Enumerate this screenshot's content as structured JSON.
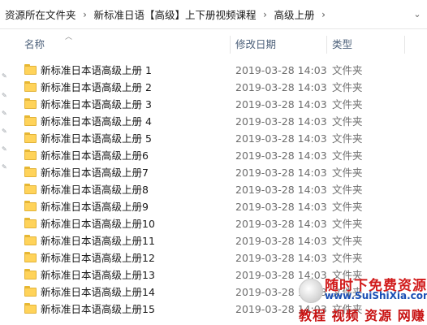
{
  "breadcrumb": {
    "items": [
      "资源所在文件夹",
      "新标准日语【高级】上下册视频课程",
      "高级上册"
    ],
    "separator": "›"
  },
  "columns": {
    "name": "名称",
    "date": "修改日期",
    "type": "类型"
  },
  "rows": [
    {
      "name": "新标准日本语高级上册 1",
      "date": "2019-03-28 14:03",
      "type": "文件夹"
    },
    {
      "name": "新标准日本语高级上册 2",
      "date": "2019-03-28 14:03",
      "type": "文件夹"
    },
    {
      "name": "新标准日本语高级上册 3",
      "date": "2019-03-28 14:03",
      "type": "文件夹"
    },
    {
      "name": "新标准日本语高级上册 4",
      "date": "2019-03-28 14:03",
      "type": "文件夹"
    },
    {
      "name": "新标准日本语高级上册 5",
      "date": "2019-03-28 14:03",
      "type": "文件夹"
    },
    {
      "name": "新标准日本语高级上册6",
      "date": "2019-03-28 14:03",
      "type": "文件夹"
    },
    {
      "name": "新标准日本语高级上册7",
      "date": "2019-03-28 14:03",
      "type": "文件夹"
    },
    {
      "name": "新标准日本语高级上册8",
      "date": "2019-03-28 14:03",
      "type": "文件夹"
    },
    {
      "name": "新标准日本语高级上册9",
      "date": "2019-03-28 14:03",
      "type": "文件夹"
    },
    {
      "name": "新标准日本语高级上册10",
      "date": "2019-03-28 14:03",
      "type": "文件夹"
    },
    {
      "name": "新标准日本语高级上册11",
      "date": "2019-03-28 14:03",
      "type": "文件夹"
    },
    {
      "name": "新标准日本语高级上册12",
      "date": "2019-03-28 14:03",
      "type": "文件夹"
    },
    {
      "name": "新标准日本语高级上册13",
      "date": "2019-03-28 14:03",
      "type": "文件夹"
    },
    {
      "name": "新标准日本语高级上册14",
      "date": "2019-03-28 14:03",
      "type": "文件夹"
    },
    {
      "name": "新标准日本语高级上册15",
      "date": "2019-03-28 14:03",
      "type": "文件夹"
    }
  ],
  "watermark": {
    "line1": "随时下免费资源网",
    "line2": "www.SuiShiXia.com",
    "line3": "教程 视频 资源 网赚"
  },
  "icons": {
    "folder": "folder-icon",
    "sort": "sort-up-icon",
    "pin": "pin-icon",
    "dropdown": "chevron-down-icon"
  },
  "colors": {
    "folder": "#ffd35a",
    "header_text": "#4c607a",
    "watermark_red": "#d11b1b",
    "watermark_blue": "#1a4fb5"
  }
}
